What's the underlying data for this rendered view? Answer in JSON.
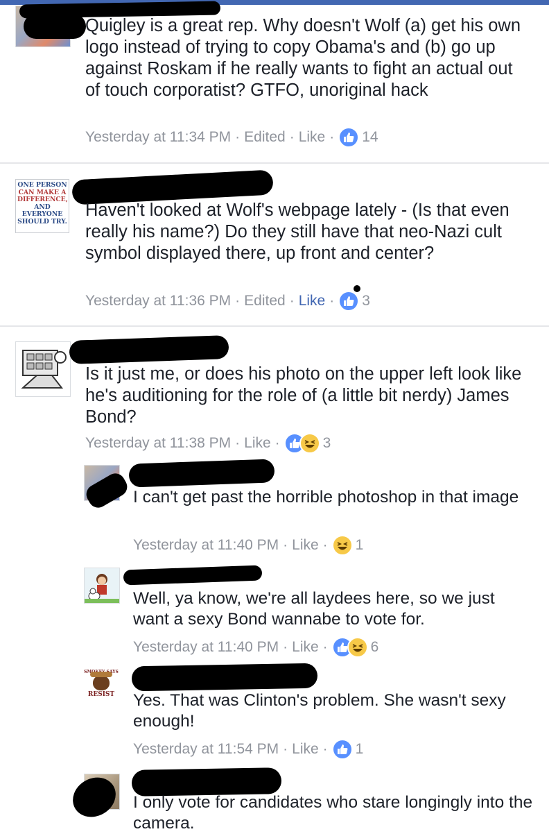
{
  "comments": [
    {
      "text": "Quigley is a great rep. Why doesn't Wolf (a) get his own logo instead of trying to copy Obama's and (b) go up against Roskam if he really wants to fight an actual out of touch corporatist? GTFO, unoriginal hack",
      "time": "Yesterday at 11:34 PM",
      "edited": "Edited",
      "like": "Like",
      "reactions": [
        "like"
      ],
      "count": "14"
    },
    {
      "avatar_text": [
        "ONE PERSON",
        "CAN MAKE A",
        "DIFFERENCE,",
        "AND EVERYONE",
        "SHOULD TRY."
      ],
      "text": "Haven't looked at Wolf's webpage lately - (Is that even really his name?) Do they still have that neo-Nazi cult symbol displayed there, up front and center?",
      "time": "Yesterday at 11:36 PM",
      "edited": "Edited",
      "like": "Like",
      "reactions": [
        "like"
      ],
      "count": "3"
    },
    {
      "text": "Is it just me, or does his photo on the upper left look like he's auditioning for the role of (a little bit nerdy) James Bond?",
      "time": "Yesterday at 11:38 PM",
      "like": "Like",
      "reactions": [
        "like",
        "haha"
      ],
      "count": "3"
    }
  ],
  "replies": [
    {
      "text": "I can't get past the horrible photoshop in that image",
      "time": "Yesterday at 11:40 PM",
      "like": "Like",
      "reactions": [
        "haha"
      ],
      "count": "1"
    },
    {
      "text": "Well, ya know, we're all laydees here, so we just want a sexy Bond wannabe to vote for.",
      "time": "Yesterday at 11:40 PM",
      "like": "Like",
      "reactions": [
        "like",
        "haha"
      ],
      "count": "6"
    },
    {
      "avatar_text": [
        "SMOKEY SAYS",
        "RESIST"
      ],
      "text": "Yes. That was Clinton's problem. She wasn't sexy enough!",
      "time": "Yesterday at 11:54 PM",
      "like": "Like",
      "reactions": [
        "like"
      ],
      "count": "1"
    },
    {
      "text": "I only vote for candidates who stare longingly into the camera."
    }
  ],
  "colors": {
    "facebook_blue": "#4267b2",
    "like_reaction": "#5890ff",
    "haha_reaction": "#f7c948",
    "meta_gray": "#90949c"
  },
  "icons": {
    "like": "thumbs-up-icon",
    "haha": "laughing-face-icon"
  }
}
